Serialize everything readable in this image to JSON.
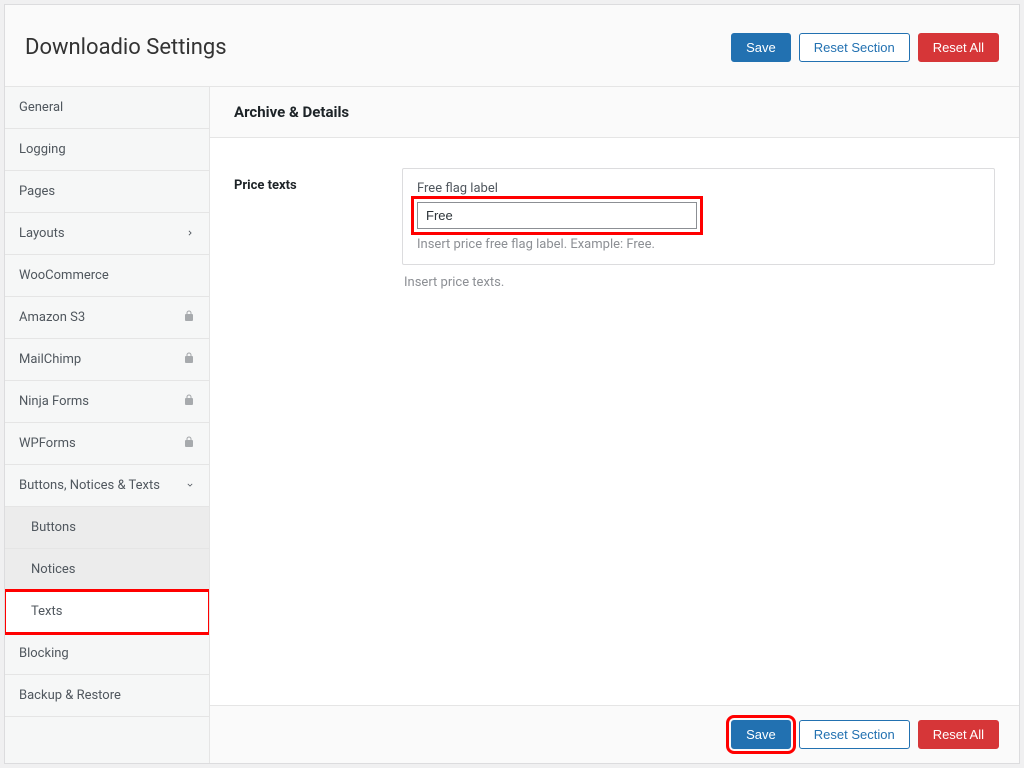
{
  "header": {
    "title": "Downloadio Settings",
    "save_label": "Save",
    "reset_section_label": "Reset Section",
    "reset_all_label": "Reset All"
  },
  "sidebar": {
    "items": [
      {
        "label": "General",
        "icon": null,
        "sub": false
      },
      {
        "label": "Logging",
        "icon": null,
        "sub": false
      },
      {
        "label": "Pages",
        "icon": null,
        "sub": false
      },
      {
        "label": "Layouts",
        "icon": "chevron-right",
        "sub": false
      },
      {
        "label": "WooCommerce",
        "icon": null,
        "sub": false
      },
      {
        "label": "Amazon S3",
        "icon": "lock",
        "sub": false
      },
      {
        "label": "MailChimp",
        "icon": "lock",
        "sub": false
      },
      {
        "label": "Ninja Forms",
        "icon": "lock",
        "sub": false
      },
      {
        "label": "WPForms",
        "icon": "lock",
        "sub": false
      },
      {
        "label": "Buttons, Notices & Texts",
        "icon": "chevron-down",
        "sub": false
      },
      {
        "label": "Buttons",
        "icon": null,
        "sub": true
      },
      {
        "label": "Notices",
        "icon": null,
        "sub": true
      },
      {
        "label": "Texts",
        "icon": null,
        "sub": true,
        "active": true,
        "highlight": true
      },
      {
        "label": "Blocking",
        "icon": null,
        "sub": false
      },
      {
        "label": "Backup & Restore",
        "icon": null,
        "sub": false
      }
    ]
  },
  "main": {
    "section_title": "Archive & Details",
    "field_label": "Price texts",
    "input_label": "Free flag label",
    "input_value": "Free",
    "input_help": "Insert price free flag label. Example: Free.",
    "outside_help": "Insert price texts."
  },
  "footer": {
    "save_label": "Save",
    "reset_section_label": "Reset Section",
    "reset_all_label": "Reset All"
  }
}
